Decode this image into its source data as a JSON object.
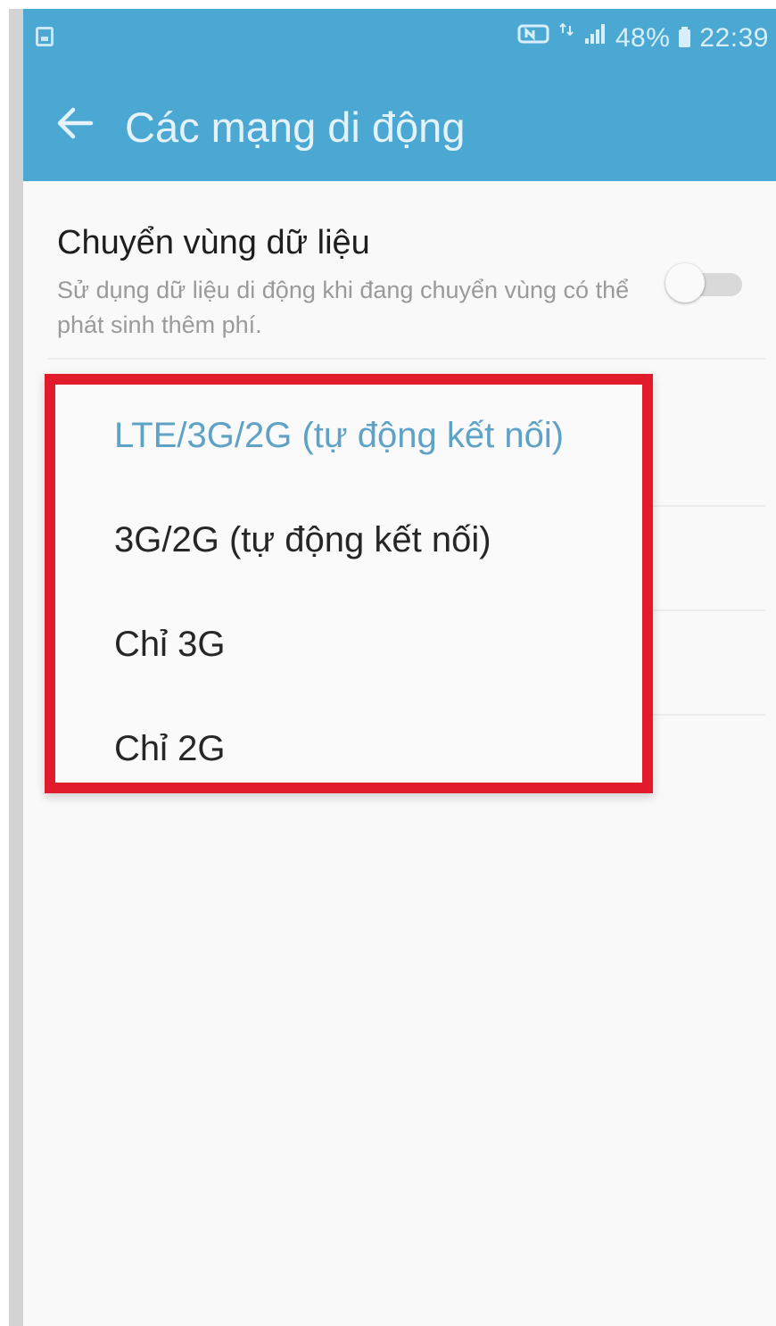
{
  "status_bar": {
    "battery_text": "48%",
    "time": "22:39",
    "left_icon": "gallery-icon",
    "icons": [
      "nfc-icon",
      "data-arrows-icon",
      "signal-icon",
      "battery-icon"
    ]
  },
  "header": {
    "back_icon": "back-arrow-icon",
    "title": "Các mạng di động"
  },
  "settings": {
    "roaming": {
      "title": "Chuyển vùng dữ liệu",
      "description": "Sử dụng dữ liệu di động khi đang chuyển vùng có thể phát sinh thêm phí.",
      "enabled": false
    }
  },
  "network_mode_popup": {
    "selected_index": 0,
    "options": [
      {
        "label": "LTE/3G/2G (tự động kết nối)"
      },
      {
        "label": "3G/2G (tự động kết nối)"
      },
      {
        "label": "Chỉ 3G"
      },
      {
        "label": "Chỉ 2G"
      }
    ]
  },
  "colors": {
    "header_bg": "#4aa8d3",
    "highlight_border": "#e21b2c",
    "selected_option_text": "#5ea2c6",
    "background": "#f9f9f9"
  }
}
